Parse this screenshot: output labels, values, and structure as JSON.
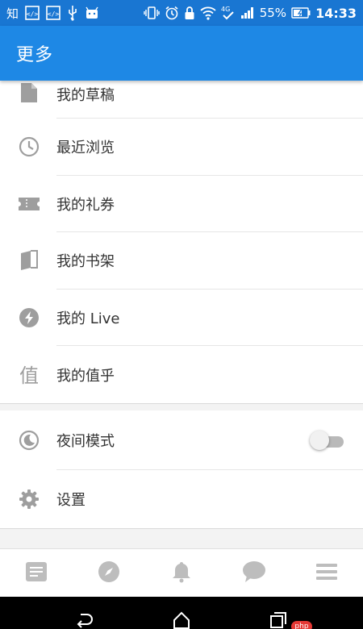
{
  "status_bar": {
    "left_icons": [
      "zhihu-app-icon",
      "code-icon",
      "code-icon",
      "usb-icon",
      "android-icon"
    ],
    "app_glyph": "知",
    "network": "4G",
    "battery": "55%",
    "time": "14:33"
  },
  "app_bar": {
    "title": "更多"
  },
  "menu_items": [
    {
      "label": "我的草稿",
      "icon": "draft-icon"
    },
    {
      "label": "最近浏览",
      "icon": "clock-icon"
    },
    {
      "label": "我的礼券",
      "icon": "ticket-icon"
    },
    {
      "label": "我的书架",
      "icon": "book-icon"
    },
    {
      "label": "我的 Live",
      "icon": "live-icon"
    },
    {
      "label": "我的值乎",
      "icon": "zhihu-value-icon"
    }
  ],
  "value_glyph": "值",
  "settings_items": [
    {
      "label": "夜间模式",
      "icon": "moon-icon",
      "toggle_on": false
    },
    {
      "label": "设置",
      "icon": "gear-icon"
    }
  ],
  "tab_bar": [
    "feed-icon",
    "compass-icon",
    "bell-icon",
    "chat-icon",
    "menu-icon"
  ],
  "nav_bar": {
    "badge": "php"
  },
  "colors": {
    "status_bar": "#1976D2",
    "app_bar": "#1E88E5",
    "icon_gray": "#9e9e9e",
    "tab_icon": "#bdbdbd"
  }
}
